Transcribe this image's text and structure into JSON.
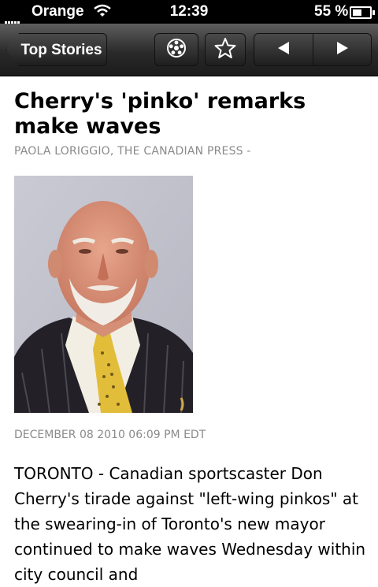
{
  "status_bar": {
    "carrier": "Orange",
    "time": "12:39",
    "battery_percent": "55 %",
    "battery_level": 0.55,
    "signal_icon": "signal-bars-icon",
    "wifi_icon": "wifi-icon",
    "battery_icon": "battery-icon"
  },
  "toolbar": {
    "back_label": "Top Stories",
    "share_icon": "share-wheel-icon",
    "favorite_icon": "star-icon",
    "prev_icon": "triangle-left-icon",
    "next_icon": "triangle-right-icon"
  },
  "article": {
    "headline": "Cherry's 'pinko' remarks make waves",
    "byline": "PAOLA LORIGGIO, THE CANADIAN PRESS  -",
    "photo_subject": "portrait-photo",
    "dateline": "DECEMBER 08 2010 06:09 PM EDT",
    "body": "TORONTO - Canadian sportscaster Don Cherry's tirade against \"left-wing pinkos\" at the swearing-in of Toronto's new mayor continued to make waves Wednesday within city council and"
  },
  "colors": {
    "toolbar_dark": "#1b1b1b",
    "meta_text": "#8a8a8a"
  }
}
